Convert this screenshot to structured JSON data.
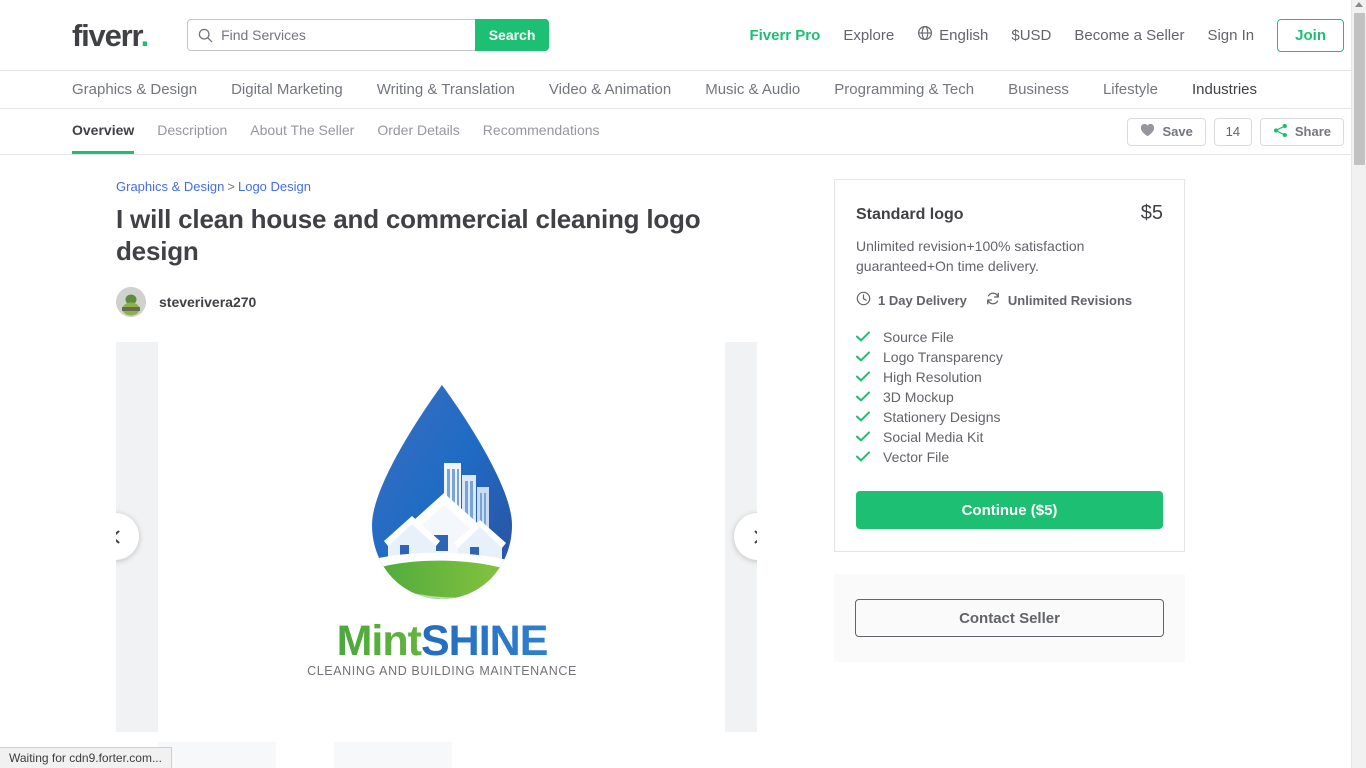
{
  "header": {
    "logo_text": "fiverr",
    "logo_dot": ".",
    "search_placeholder": "Find Services",
    "search_value": "",
    "search_button": "Search",
    "pro_link": "Fiverr Pro",
    "explore_link": "Explore",
    "language": "English",
    "currency": "$USD",
    "become_seller": "Become a Seller",
    "sign_in": "Sign In",
    "join": "Join"
  },
  "categories": [
    "Graphics & Design",
    "Digital Marketing",
    "Writing & Translation",
    "Video & Animation",
    "Music & Audio",
    "Programming & Tech",
    "Business",
    "Lifestyle",
    "Industries"
  ],
  "tabs": [
    {
      "label": "Overview",
      "active": true
    },
    {
      "label": "Description",
      "active": false
    },
    {
      "label": "About The Seller",
      "active": false
    },
    {
      "label": "Order Details",
      "active": false
    },
    {
      "label": "Recommendations",
      "active": false
    }
  ],
  "tab_actions": {
    "save_label": "Save",
    "save_count": "14",
    "share_label": "Share"
  },
  "gig": {
    "breadcrumb": {
      "category": "Graphics & Design",
      "separator": ">",
      "subcategory": "Logo Design"
    },
    "title": "I will clean house and commercial cleaning logo design",
    "seller_name": "steverivera270",
    "gallery": {
      "logo_word_1": "Mint",
      "logo_word_2": "SHINE",
      "logo_tagline": "CLEANING AND BUILDING MAINTENANCE",
      "prev_label": "Previous image",
      "next_label": "Next image"
    }
  },
  "package": {
    "name": "Standard logo",
    "price": "$5",
    "description": "Unlimited revision+100% satisfaction guaranteed+On time delivery.",
    "delivery": "1 Day Delivery",
    "revisions": "Unlimited Revisions",
    "features": [
      "Source File",
      "Logo Transparency",
      "High Resolution",
      "3D Mockup",
      "Stationery Designs",
      "Social Media Kit",
      "Vector File"
    ],
    "continue_button": "Continue ($5)",
    "contact_button": "Contact Seller"
  },
  "status_bar": {
    "text": "Waiting for cdn9.forter.com..."
  },
  "colors": {
    "brand_green": "#1dbf73",
    "link_blue": "#446ee7",
    "text_dark": "#404145",
    "text_muted": "#74767e"
  }
}
